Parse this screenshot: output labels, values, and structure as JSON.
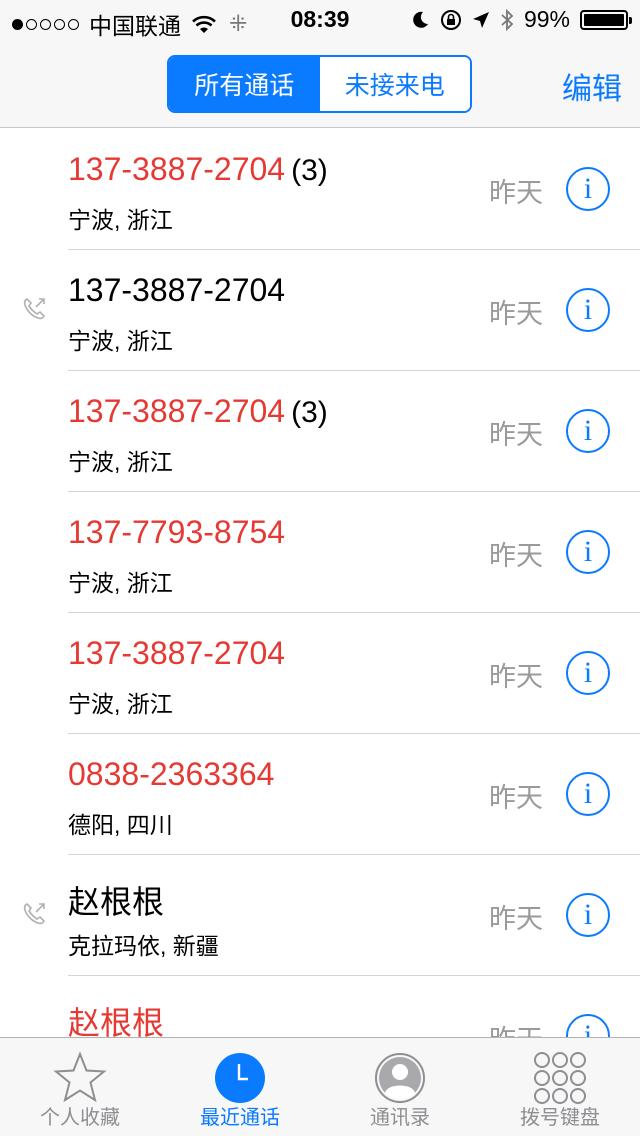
{
  "status_bar": {
    "carrier": "中国联通",
    "time": "08:39",
    "battery": "99%",
    "battery_level": 0.99
  },
  "nav": {
    "segments": [
      {
        "label": "所有通话",
        "active": true
      },
      {
        "label": "未接来电",
        "active": false
      }
    ],
    "edit_label": "编辑"
  },
  "calls": [
    {
      "name": "137-3887-2704",
      "count": "(3)",
      "location": "宁波, 浙江",
      "date": "昨天",
      "missed": true,
      "outgoing": false
    },
    {
      "name": "137-3887-2704",
      "count": "",
      "location": "宁波, 浙江",
      "date": "昨天",
      "missed": false,
      "outgoing": true
    },
    {
      "name": "137-3887-2704",
      "count": "(3)",
      "location": "宁波, 浙江",
      "date": "昨天",
      "missed": true,
      "outgoing": false
    },
    {
      "name": "137-7793-8754",
      "count": "",
      "location": "宁波, 浙江",
      "date": "昨天",
      "missed": true,
      "outgoing": false
    },
    {
      "name": "137-3887-2704",
      "count": "",
      "location": "宁波, 浙江",
      "date": "昨天",
      "missed": true,
      "outgoing": false
    },
    {
      "name": "0838-2363364",
      "count": "",
      "location": "德阳, 四川",
      "date": "昨天",
      "missed": true,
      "outgoing": false
    },
    {
      "name": "赵根根",
      "count": "",
      "location": "克拉玛依, 新疆",
      "date": "昨天",
      "missed": false,
      "outgoing": true
    },
    {
      "name": "赵根根",
      "count": "",
      "location": "",
      "date": "昨天",
      "missed": true,
      "outgoing": false
    }
  ],
  "info_glyph": "i",
  "tabs": [
    {
      "label": "个人收藏",
      "icon": "star-icon",
      "active": false
    },
    {
      "label": "最近通话",
      "icon": "clock-icon",
      "active": true
    },
    {
      "label": "通讯录",
      "icon": "contacts-icon",
      "active": false
    },
    {
      "label": "拨号键盘",
      "icon": "keypad-icon",
      "active": false
    }
  ],
  "colors": {
    "accent": "#0a7aff",
    "missed": "#e53a34",
    "date": "#9a9a9a"
  }
}
